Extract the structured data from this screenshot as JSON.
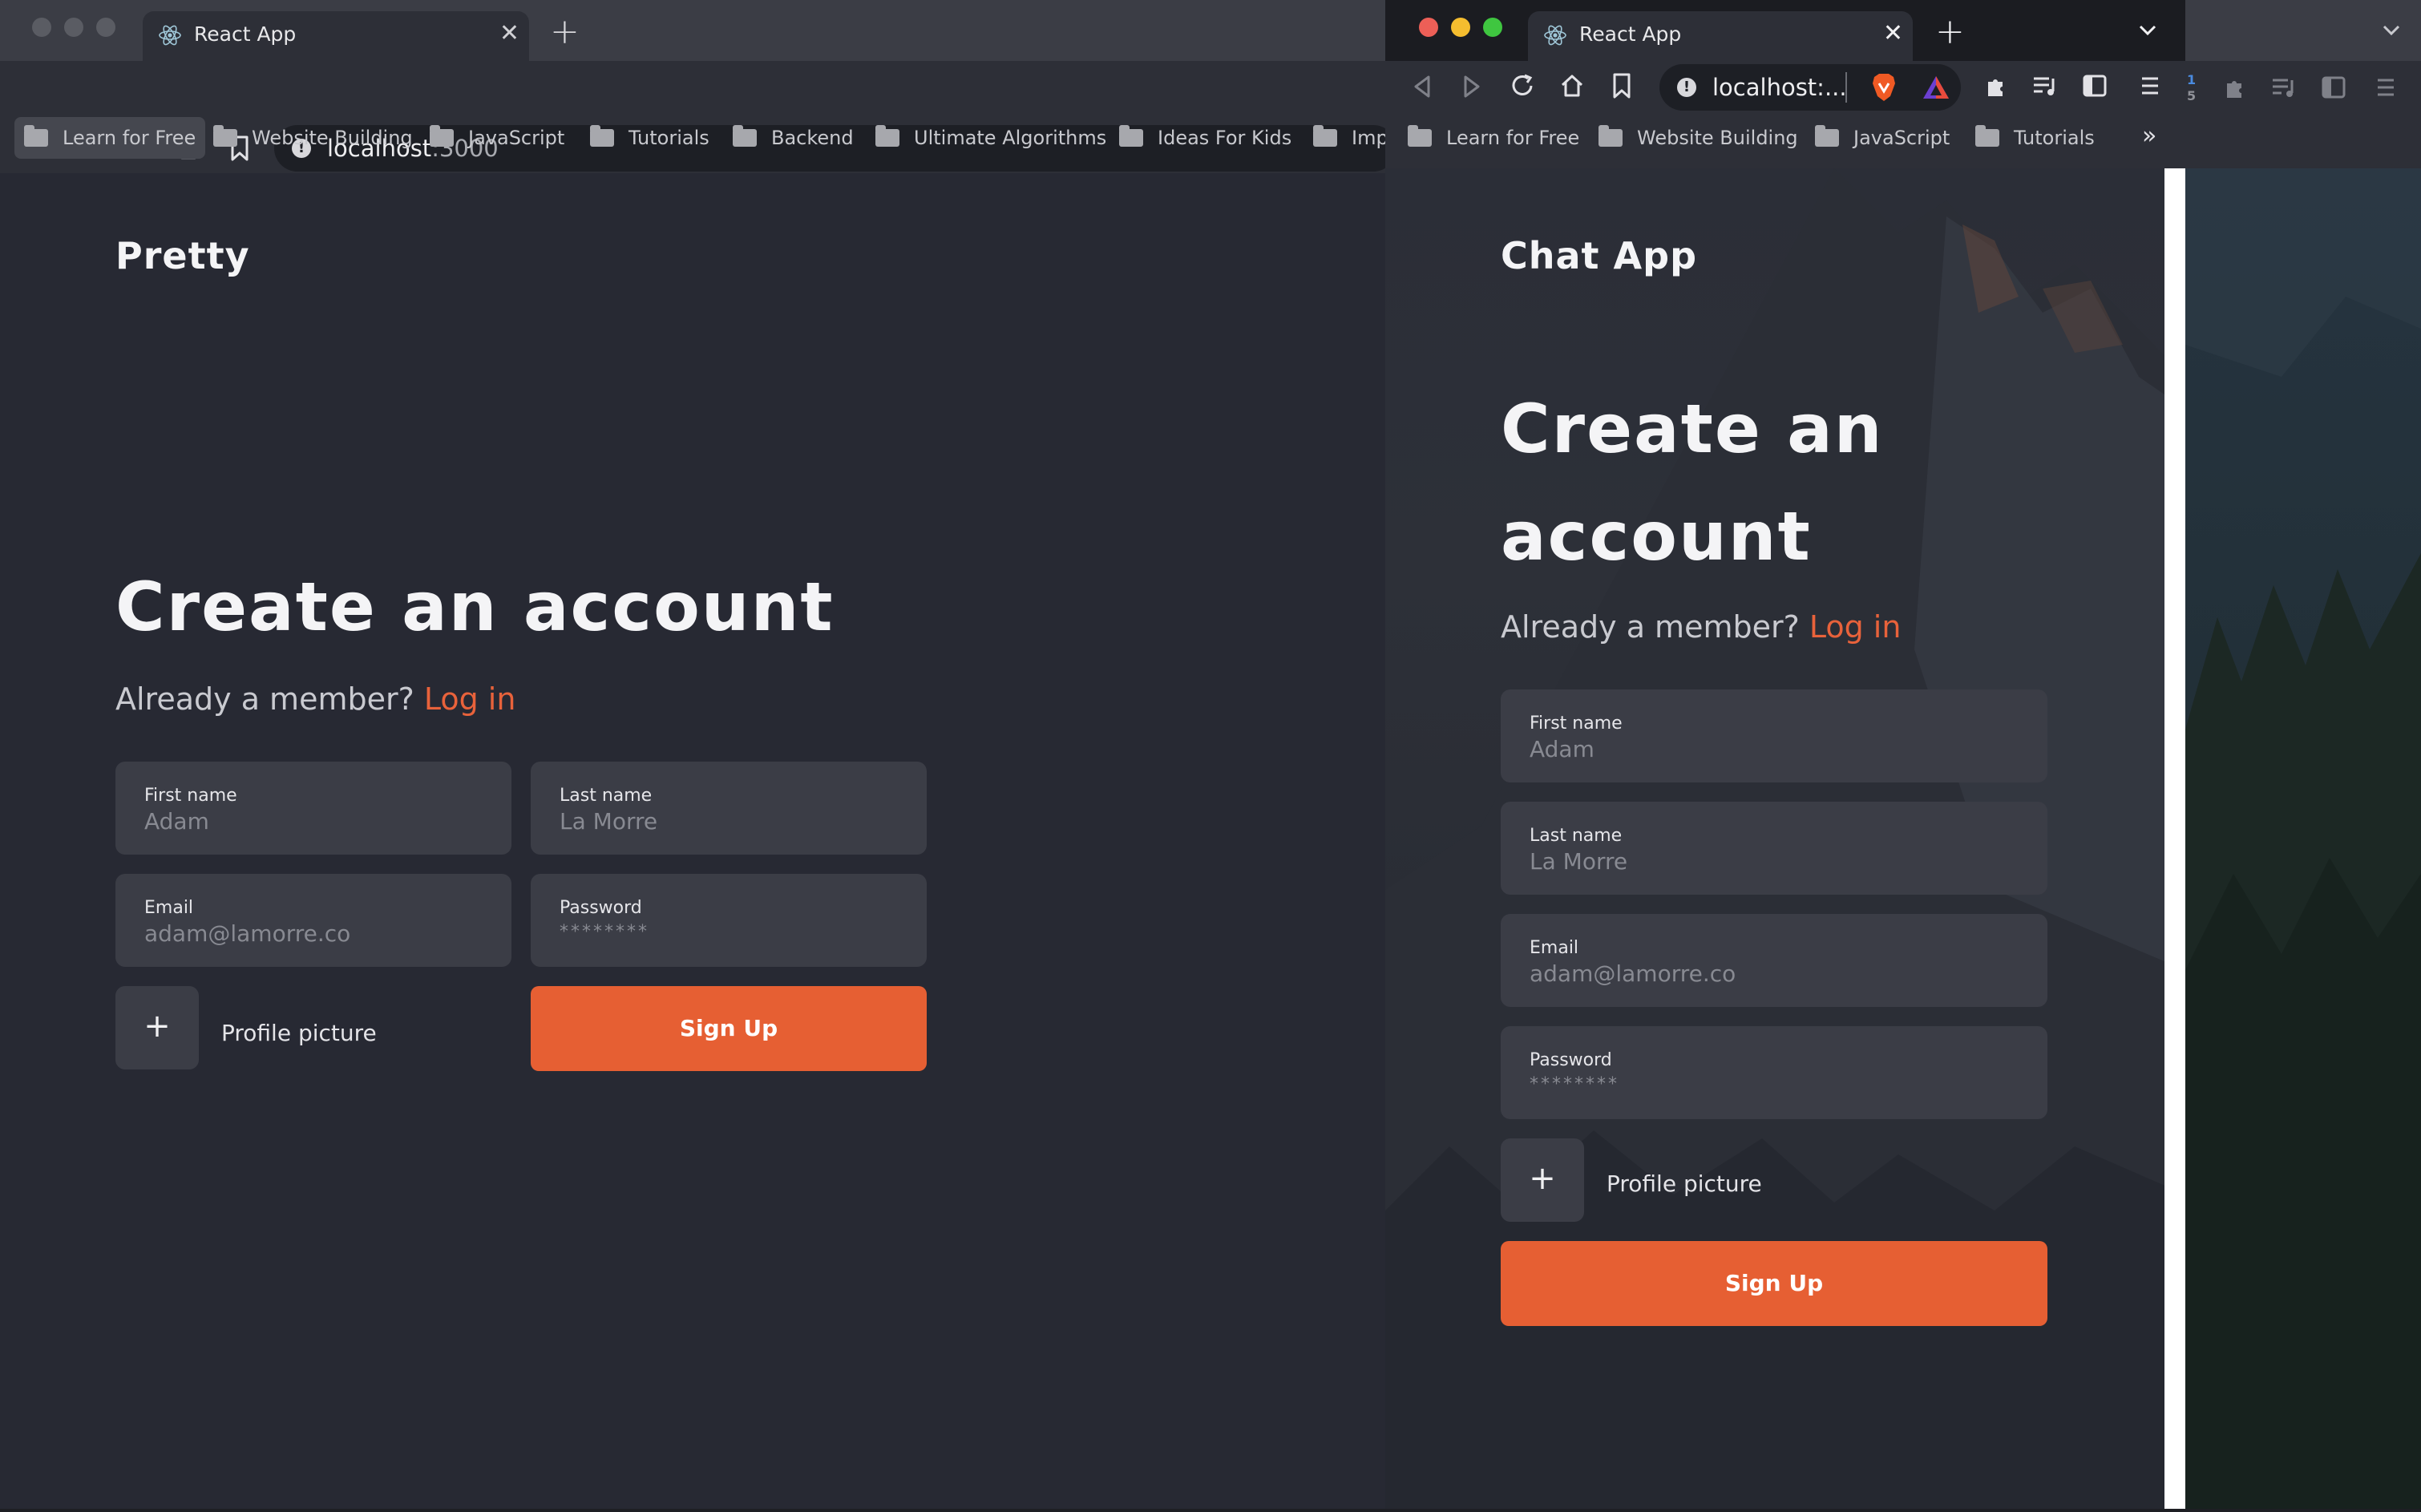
{
  "back_window": {
    "tab_title": "React App",
    "url_host": "localhost",
    "url_port": ":3000",
    "bookmarks": [
      "Learn for Free",
      "Website Building",
      "JavaScript",
      "Tutorials",
      "Backend",
      "Ultimate Algorithms",
      "Ideas For Kids",
      "Imp"
    ],
    "page": {
      "brand": "Pretty",
      "heading": "Create an account",
      "subtitle": "Already a member?",
      "login_link": "Log in",
      "fields": {
        "first_name": {
          "label": "First name",
          "value": "Adam"
        },
        "last_name": {
          "label": "Last name",
          "value": "La Morre"
        },
        "email": {
          "label": "Email",
          "value": "adam@lamorre.co"
        },
        "password": {
          "label": "Password",
          "value": "********"
        }
      },
      "plus": "+",
      "profile_picture": "Profile picture",
      "signup": "Sign Up"
    }
  },
  "front_window": {
    "tab_title": "React App",
    "url_text": "localhost:...",
    "bookmarks": [
      "Learn for Free",
      "Website Building",
      "JavaScript",
      "Tutorials"
    ],
    "overflow": "»",
    "page": {
      "brand": "Chat App",
      "heading_line1": "Create an",
      "heading_line2": "account",
      "subtitle": "Already a member?",
      "login_link": "Log in",
      "fields": {
        "first_name": {
          "label": "First name",
          "value": "Adam"
        },
        "last_name": {
          "label": "Last name",
          "value": "La Morre"
        },
        "email": {
          "label": "Email",
          "value": "adam@lamorre.co"
        },
        "password": {
          "label": "Password",
          "value": "********"
        }
      },
      "plus": "+",
      "profile_picture": "Profile picture",
      "signup": "Sign Up"
    }
  },
  "badge_counts": [
    "1",
    "5"
  ],
  "colors": {
    "accent": "#e65f33",
    "field_bg": "#3b3d46",
    "page_bg": "#272933"
  },
  "icons": [
    "react-icon",
    "close-icon",
    "plus-icon",
    "back-icon",
    "forward-icon",
    "reload-icon",
    "home-icon",
    "bookmark-icon",
    "info-icon",
    "brave-shield-icon",
    "brave-rewards-icon",
    "extensions-icon",
    "playlist-icon",
    "sidebar-icon",
    "menu-icon",
    "chevron-down-icon",
    "folder-icon"
  ]
}
